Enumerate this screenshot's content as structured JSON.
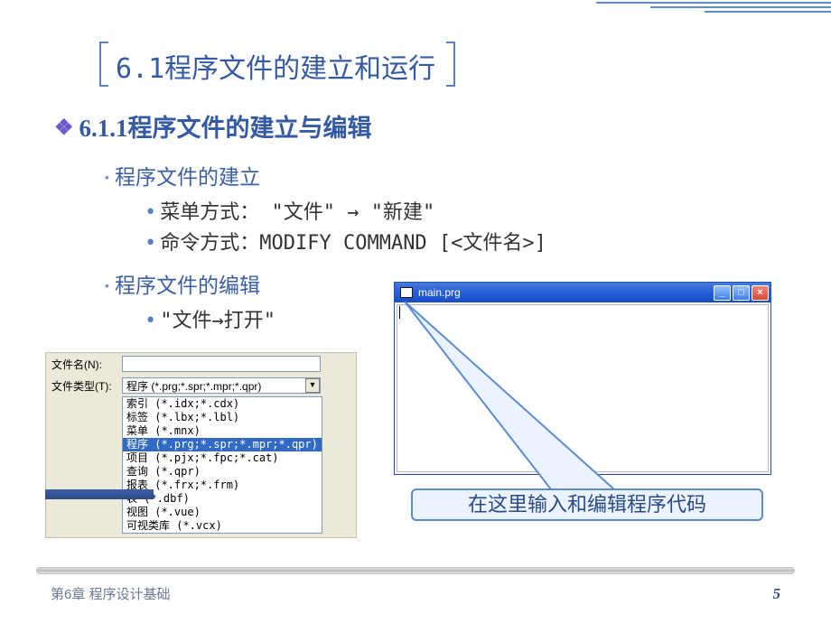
{
  "section_title": "6.1程序文件的建立和运行",
  "h1": "6.1.1程序文件的建立与编辑",
  "sub1": {
    "title": "程序文件的建立",
    "items": [
      "菜单方式：  \"文件\" → \"新建\"",
      "命令方式：MODIFY COMMAND [<文件名>]"
    ]
  },
  "sub2": {
    "title": "程序文件的编辑",
    "items": [
      "\"文件→打开\""
    ]
  },
  "file_dialog": {
    "filename_label": "文件名(N):",
    "filetype_label": "文件类型(T):",
    "combo_value": "程序 (*.prg;*.spr;*.mpr;*.qpr)",
    "list": [
      {
        "text": "索引 (*.idx;*.cdx)",
        "selected": false
      },
      {
        "text": "标签 (*.lbx;*.lbl)",
        "selected": false
      },
      {
        "text": "菜单 (*.mnx)",
        "selected": false
      },
      {
        "text": "程序 (*.prg;*.spr;*.mpr;*.qpr)",
        "selected": true
      },
      {
        "text": "项目 (*.pjx;*.fpc;*.cat)",
        "selected": false
      },
      {
        "text": "查询 (*.qpr)",
        "selected": false
      },
      {
        "text": "报表 (*.frx;*.frm)",
        "selected": false
      },
      {
        "text": "表 (*.dbf)",
        "selected": false
      },
      {
        "text": "视图 (*.vue)",
        "selected": false
      },
      {
        "text": "可视类库 (*.vcx)",
        "selected": false
      }
    ]
  },
  "editor": {
    "title": "main.prg"
  },
  "callout": "在这里输入和编辑程序代码",
  "footer": {
    "chapter": "第6章 程序设计基础",
    "page": "5"
  }
}
